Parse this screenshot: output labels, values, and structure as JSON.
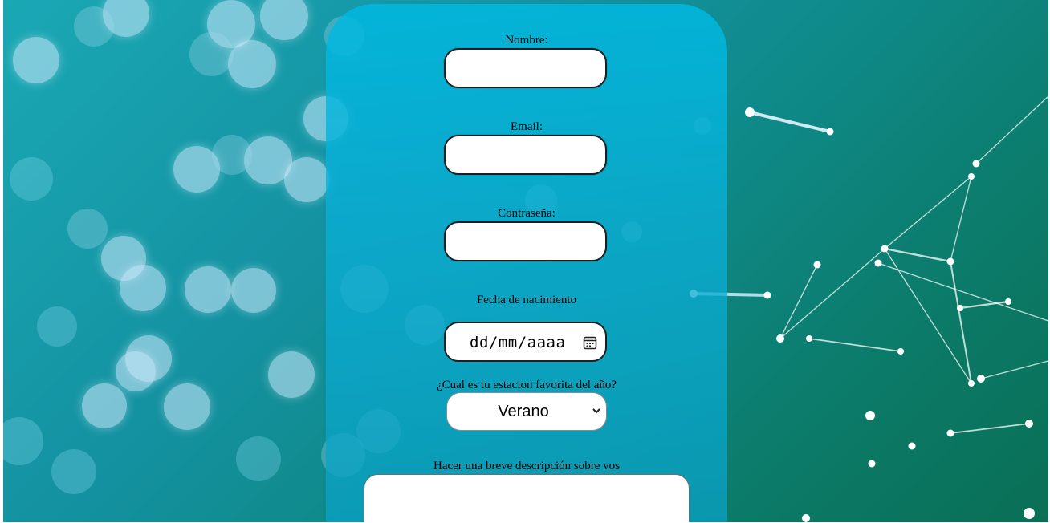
{
  "form": {
    "name_label": "Nombre:",
    "name_value": "",
    "email_label": "Email:",
    "email_value": "",
    "password_label": "Contraseña:",
    "password_value": "",
    "birthdate_label": "Fecha de nacimiento",
    "birthdate_placeholder": "dd/mm/aaaa",
    "season_label": "¿Cual es tu estacion favorita del año?",
    "season_selected": "Verano",
    "description_label": "Hacer una breve descripción sobre vos",
    "description_value": ""
  },
  "icons": {
    "date": "calendar-icon",
    "select": "chevron-down-icon"
  },
  "colors": {
    "panel": "#12b4d6",
    "background_left": "#1aa8b5",
    "background_right": "#0a6f55",
    "field_border": "#1e1e1e"
  }
}
